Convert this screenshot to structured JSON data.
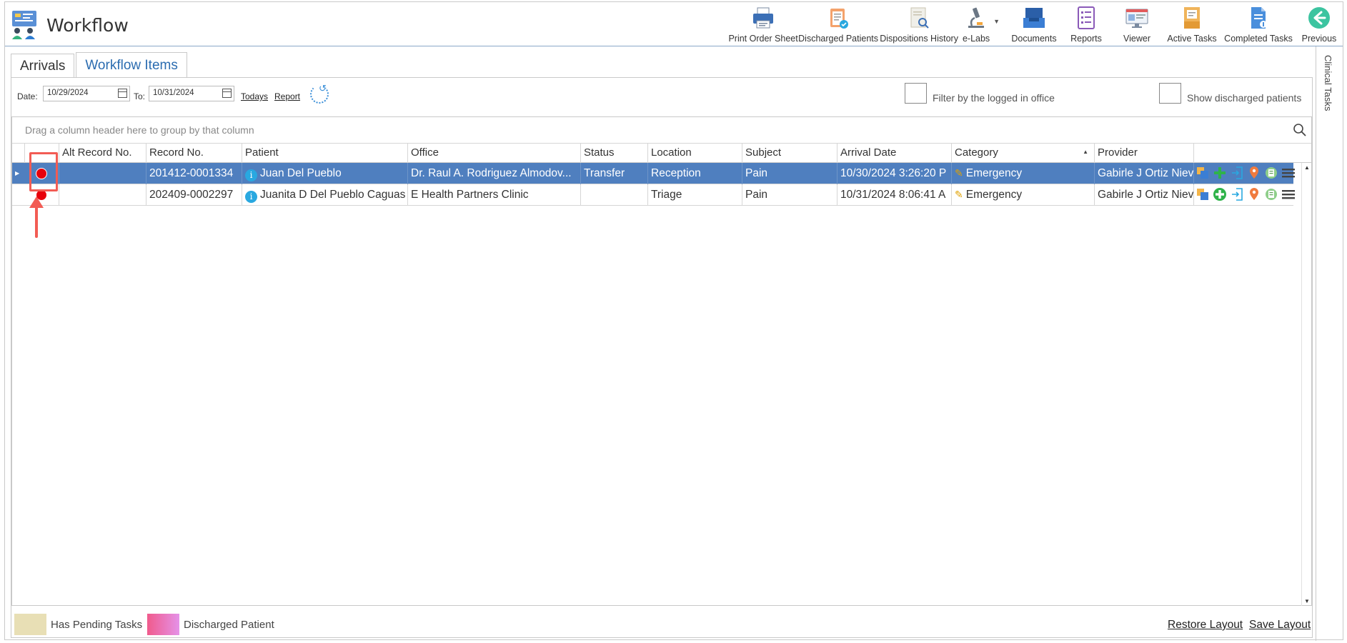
{
  "app": {
    "title": "Workflow"
  },
  "toolbar": {
    "buttons": [
      {
        "label": "Print Order Sheet",
        "icon": "printer-icon"
      },
      {
        "label": "Discharged Patients",
        "icon": "clipboard-check-icon"
      },
      {
        "label": "Dispositions History",
        "icon": "document-search-icon"
      },
      {
        "label": "e-Labs",
        "icon": "microscope-icon"
      },
      {
        "label": "Documents",
        "icon": "inbox-tray-icon"
      },
      {
        "label": "Reports",
        "icon": "report-list-icon"
      },
      {
        "label": "Viewer",
        "icon": "monitor-icon"
      },
      {
        "label": "Active Tasks",
        "icon": "task-box-icon"
      },
      {
        "label": "Completed Tasks",
        "icon": "completed-document-icon"
      },
      {
        "label": "Previous",
        "icon": "back-arrow-icon"
      }
    ]
  },
  "side_tab": {
    "label": "Clinical Tasks"
  },
  "tabs": {
    "arrivals": "Arrivals",
    "workflow_items": "Workflow Items"
  },
  "filters": {
    "date_label": "Date:",
    "date_from": "10/29/2024",
    "to_label": "To:",
    "date_to": "10/31/2024",
    "todays_link": "Todays",
    "report_link": "Report",
    "filter_office_label": "Filter by the logged in office",
    "show_discharged_label": "Show discharged patients"
  },
  "grid": {
    "group_panel_text": "Drag a column header here to group by that column",
    "columns": {
      "alt_record": "Alt Record No.",
      "record": "Record No.",
      "patient": "Patient",
      "office": "Office",
      "status": "Status",
      "location": "Location",
      "subject": "Subject",
      "arrival_date": "Arrival Date",
      "category": "Category",
      "provider": "Provider"
    },
    "rows": [
      {
        "alt_record": "",
        "record": "201412-0001334",
        "patient": "Juan Del Pueblo",
        "office": "Dr. Raul A. Rodriguez Almodov...",
        "status": "Transfer",
        "location": "Reception",
        "subject": "Pain",
        "arrival_date": "10/30/2024 3:26:20 P",
        "category": "Emergency",
        "provider": "Gabirle J Ortiz Nieve"
      },
      {
        "alt_record": "",
        "record": "202409-0002297",
        "patient": "Juanita D Del Pueblo Caguas",
        "office": "E Health Partners Clinic",
        "status": "",
        "location": "Triage",
        "subject": "Pain",
        "arrival_date": "10/31/2024 8:06:41 A",
        "category": "Emergency",
        "provider": "Gabirle J Ortiz Nieve"
      }
    ]
  },
  "legend": {
    "pending": "Has Pending Tasks",
    "discharged": "Discharged Patient",
    "restore_layout": "Restore Layout",
    "save_layout": "Save Layout"
  },
  "colors": {
    "selected_row": "#4f7fbf",
    "pending_swatch": "#e8dfb5",
    "discharged_swatch_from": "#f05a8c",
    "discharged_swatch_to": "#e592e8",
    "highlight": "#f25c54",
    "status_dot": "#e8000b"
  }
}
